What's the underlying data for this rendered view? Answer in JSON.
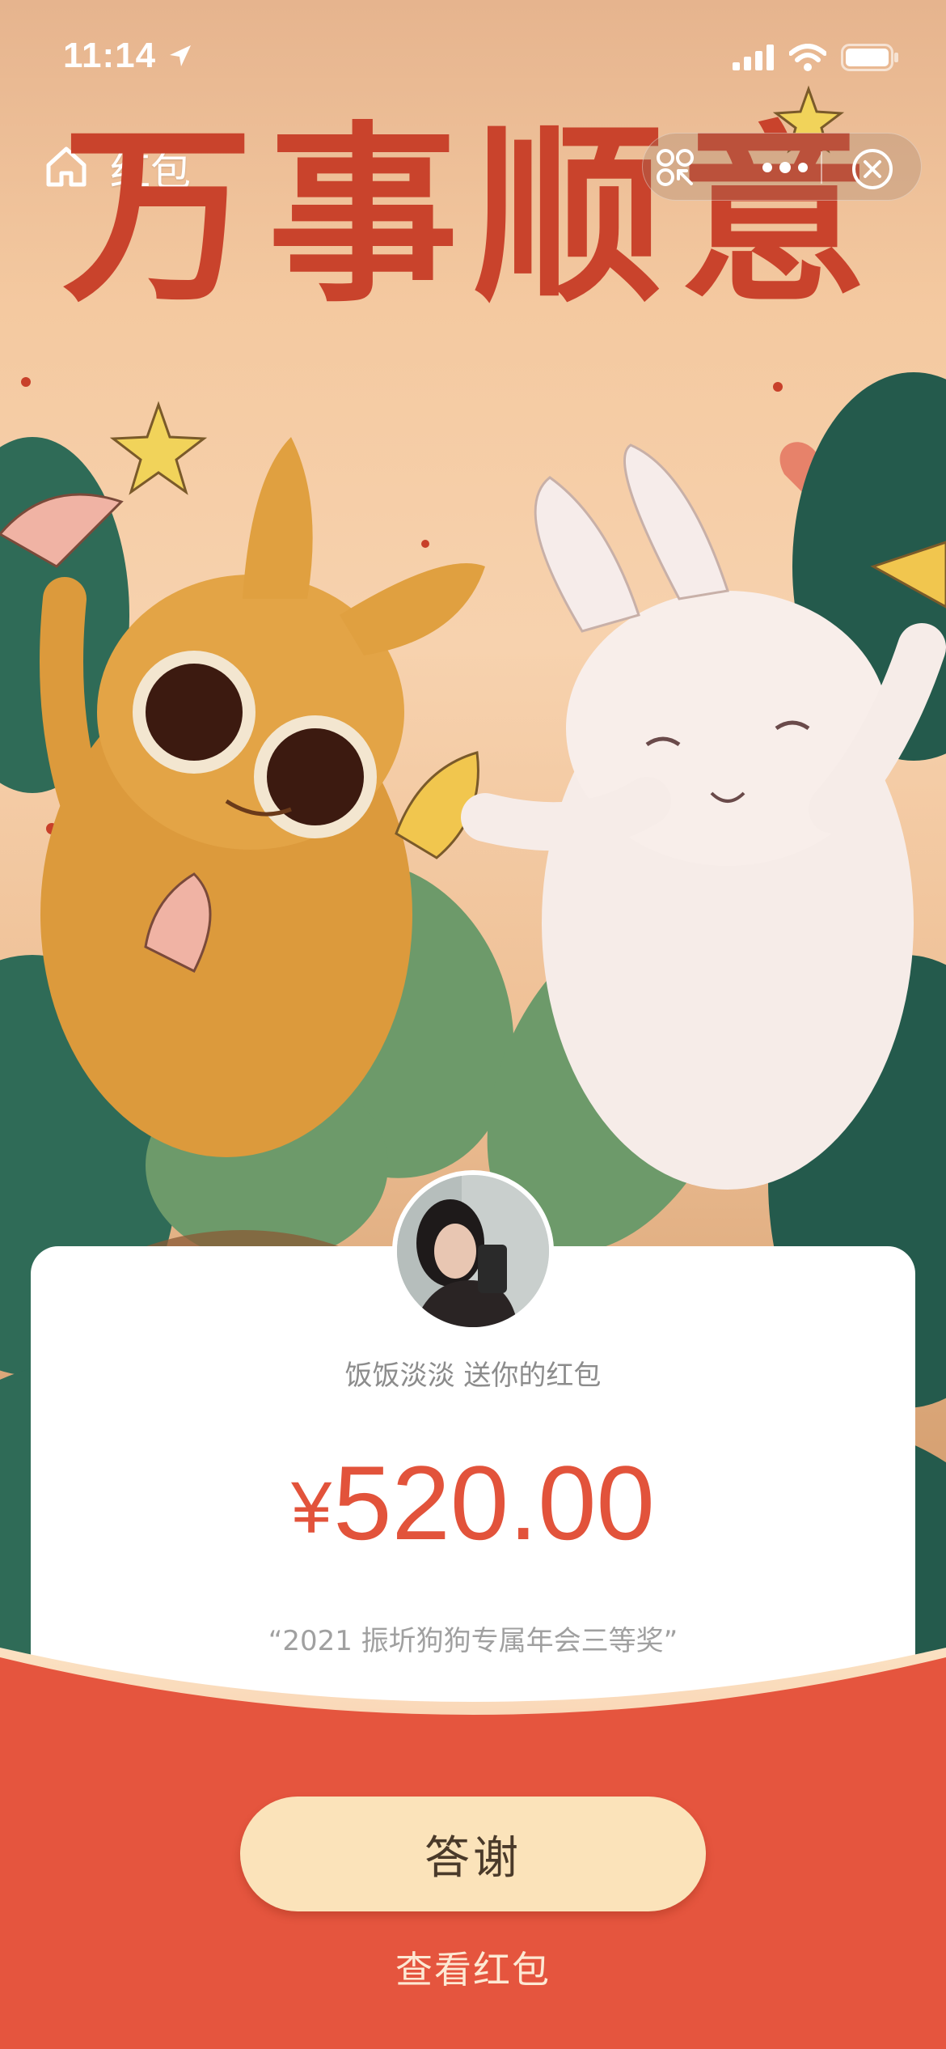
{
  "status_bar": {
    "time": "11:14"
  },
  "nav": {
    "title": "红包"
  },
  "banner": {
    "text": "万事顺意"
  },
  "envelope": {
    "sender_line": "饭饭淡淡 送你的红包",
    "currency": "¥",
    "amount": "520.00",
    "memo": "“2021 振圻狗狗专属年会三等奖”"
  },
  "actions": {
    "thanks_label": "答谢",
    "view_label": "查看红包"
  },
  "icons": [
    "location-arrow-icon",
    "signal-icon",
    "wifi-icon",
    "battery-icon",
    "home-icon",
    "scan-icon",
    "more-icon",
    "close-icon"
  ],
  "colors": {
    "accent_red": "#e2533b",
    "button_cream": "#fbe3ba",
    "banner_red": "#c9432c"
  }
}
